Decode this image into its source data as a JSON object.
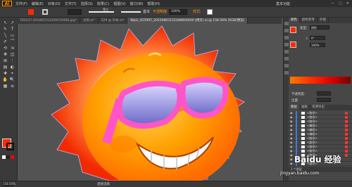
{
  "app": {
    "logo": "Ai",
    "menus": [
      "文件(F)",
      "编辑(E)",
      "对象(O)",
      "文字(T)",
      "选择(S)",
      "效果(C)",
      "视图(V)",
      "窗口(W)",
      "帮助(H)"
    ],
    "workspace": "基本功能",
    "window_buttons": [
      "—",
      "▢",
      "✕"
    ]
  },
  "controlbar": {
    "fill_color": "#ff2a00",
    "stroke_value": "",
    "stroke_style_label": "等比",
    "basic_label": "基本",
    "opacity_label": "不透明度:",
    "opacity_value": "100%",
    "style_label": "样式:"
  },
  "tabs": [
    {
      "label": "785437-201805152209154900.jpg*",
      "active": false
    },
    {
      "label": "太阳.ai*",
      "active": false
    },
    {
      "label": "S29 @ 日本.ai*",
      "active": false
    },
    {
      "label": "Nipic_455997_20150803155348604000 (拷贝).ai @ 158.56% (RGB/预览)",
      "active": true
    }
  ],
  "tools": [
    "↖",
    "↗",
    "✎",
    "T",
    "╲",
    "▭",
    "✐",
    "⌒",
    "⟲",
    "⇲",
    "✥",
    "◫",
    "⊞",
    "⋮",
    "▤",
    "◐",
    "✚",
    "⌖",
    "✋",
    "🔍",
    "▦",
    "≡"
  ],
  "status": {
    "zoom": "158.56%",
    "tool_text": "直接选择"
  },
  "color_panel": {
    "tab1": "颜色",
    "tab2": "颜色参考",
    "tab3": "外观",
    "fill_color": "#ff2a00",
    "type_label": "类型:",
    "type_value": "线性",
    "angle_label": "△",
    "angle_value": "0°",
    "ratio_value": "100%",
    "opacity_label": "不透明度:",
    "location_label": "位置:",
    "ramp_colors": [
      "#ff7a00",
      "#ff3000",
      "#e00000",
      "#7a0000"
    ]
  },
  "layers_panel": {
    "tabs": [
      "图层",
      "画板",
      "资源导出"
    ],
    "rows": [
      {
        "name": "<路径>",
        "selected": true
      },
      {
        "name": "<路径>",
        "selected": true
      },
      {
        "name": "<路径>",
        "selected": true
      },
      {
        "name": "<编组>",
        "selected": true
      },
      {
        "name": "<编组>",
        "selected": true
      },
      {
        "name": "<编组>",
        "selected": true
      },
      {
        "name": "<路径>",
        "selected": true
      },
      {
        "name": "<路径>",
        "selected": true
      },
      {
        "name": "<路径>",
        "selected": true
      },
      {
        "name": "<路径>",
        "selected": true
      },
      {
        "name": "<路径>",
        "selected": true
      },
      {
        "name": "<路径>",
        "selected": false
      },
      {
        "name": "<路径>",
        "selected": false
      }
    ],
    "footer": "1 个图层"
  },
  "watermark": {
    "brand": "Baidu 经验",
    "url": "jingyan.baidu.com"
  },
  "artwork": {
    "sun_outer": "#f22800",
    "sun_inner": "#ff7a00",
    "face": "#ffa000",
    "glasses_frame": "#ff55c8",
    "lens": "#6a66c8"
  }
}
